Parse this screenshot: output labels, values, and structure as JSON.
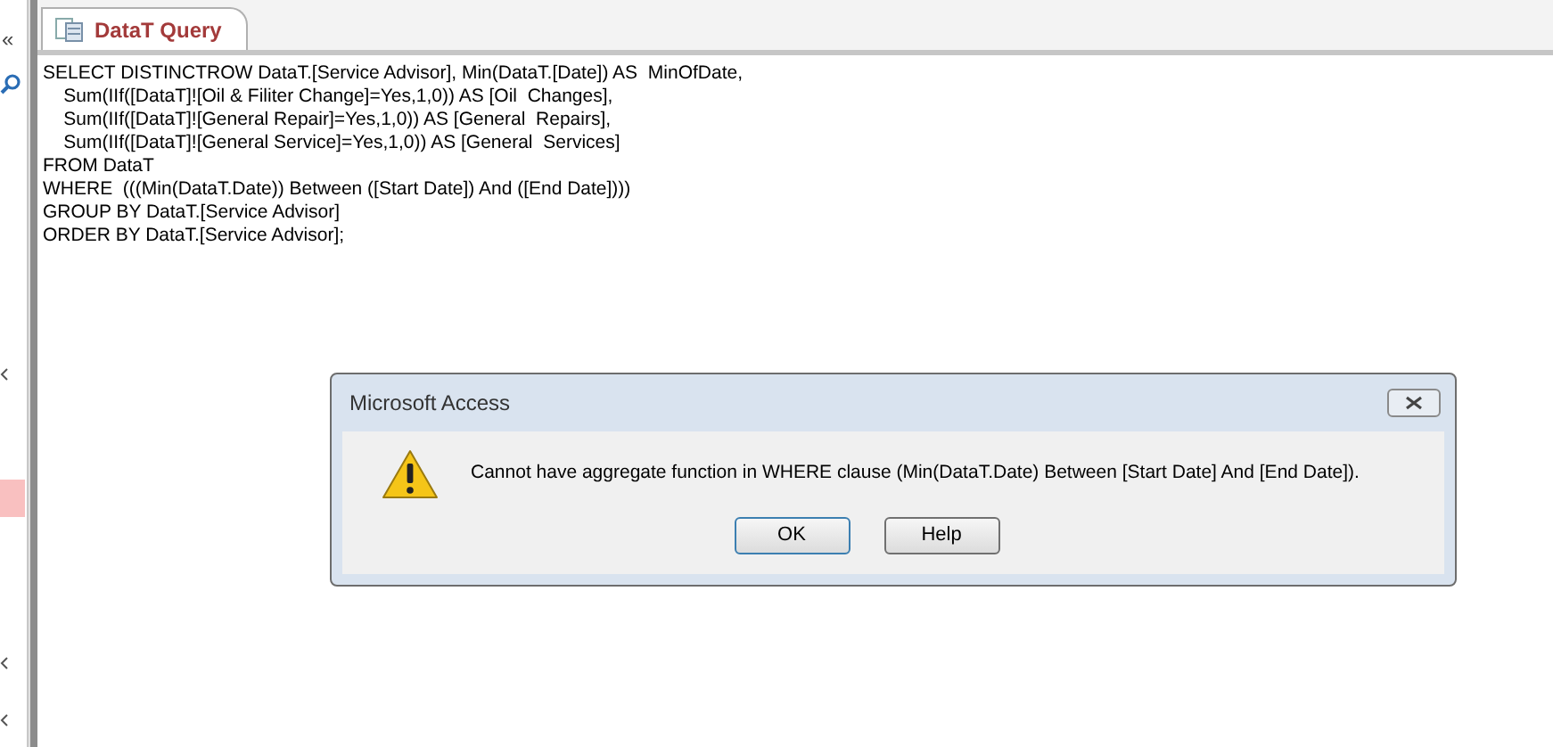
{
  "nav_pane": {
    "collapse_glyph": "«"
  },
  "tab": {
    "title": "DataT Query",
    "selected": true
  },
  "sql_lines": [
    "SELECT DISTINCTROW DataT.[Service Advisor], Min(DataT.[Date]) AS  MinOfDate,",
    "    Sum(IIf([DataT]![Oil & Filiter Change]=Yes,1,0)) AS [Oil  Changes],",
    "    Sum(IIf([DataT]![General Repair]=Yes,1,0)) AS [General  Repairs],",
    "    Sum(IIf([DataT]![General Service]=Yes,1,0)) AS [General  Services]",
    "FROM DataT",
    "WHERE  (((Min(DataT.Date)) Between ([Start Date]) And ([End Date])))",
    "GROUP BY DataT.[Service Advisor]",
    "ORDER BY DataT.[Service Advisor];"
  ],
  "dialog": {
    "title": "Microsoft Access",
    "message": "Cannot have aggregate function in WHERE clause (Min(DataT.Date) Between [Start Date] And [End Date]).",
    "buttons": [
      "OK",
      "Help"
    ]
  }
}
